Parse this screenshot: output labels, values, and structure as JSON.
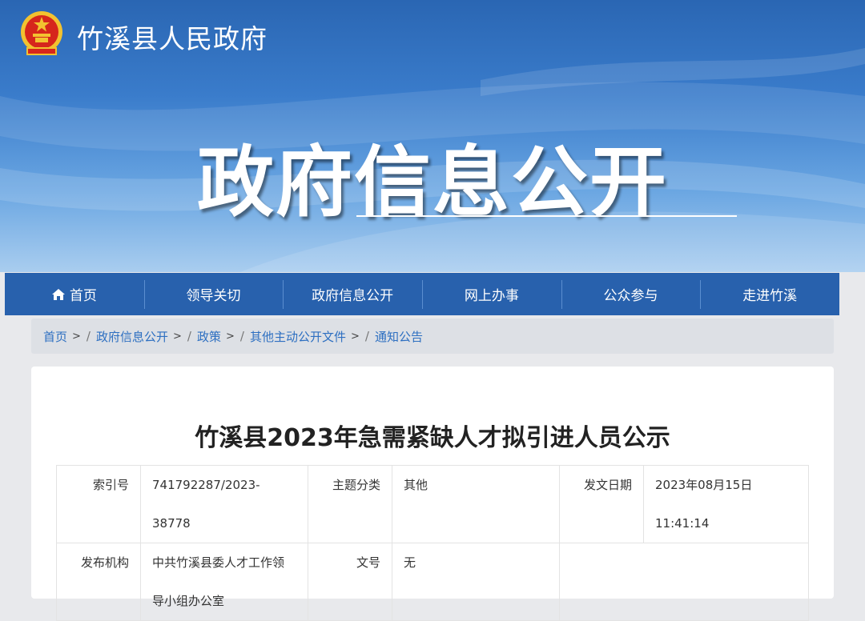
{
  "header": {
    "site_name": "竹溪县人民政府",
    "hero_title": "政府信息公开",
    "emblem_icon": "national-emblem-icon"
  },
  "colors": {
    "nav_bg": "#2861ad",
    "link": "#2d6fc1",
    "banner_top": "#2a66b3"
  },
  "nav": {
    "items": [
      {
        "label": "首页",
        "icon": "home-icon"
      },
      {
        "label": "领导关切"
      },
      {
        "label": "政府信息公开"
      },
      {
        "label": "网上办事"
      },
      {
        "label": "公众参与"
      },
      {
        "label": "走进竹溪"
      }
    ]
  },
  "breadcrumb": {
    "items": [
      "首页",
      "政府信息公开",
      "政策",
      "其他主动公开文件",
      "通知公告"
    ],
    "separator": ">",
    "divider": "/"
  },
  "article": {
    "title": "竹溪县2023年急需紧缺人才拟引进人员公示",
    "meta": {
      "index_label": "索引号",
      "index_value": "741792287/2023-38778",
      "category_label": "主题分类",
      "category_value": "其他",
      "date_label": "发文日期",
      "date_value": "2023年08月15日 11:41:14",
      "publisher_label": "发布机构",
      "publisher_line1": "中共竹溪县委人才工作领",
      "publisher_line2": "导小组办公室",
      "docno_label": "文号",
      "docno_value": "无"
    }
  }
}
